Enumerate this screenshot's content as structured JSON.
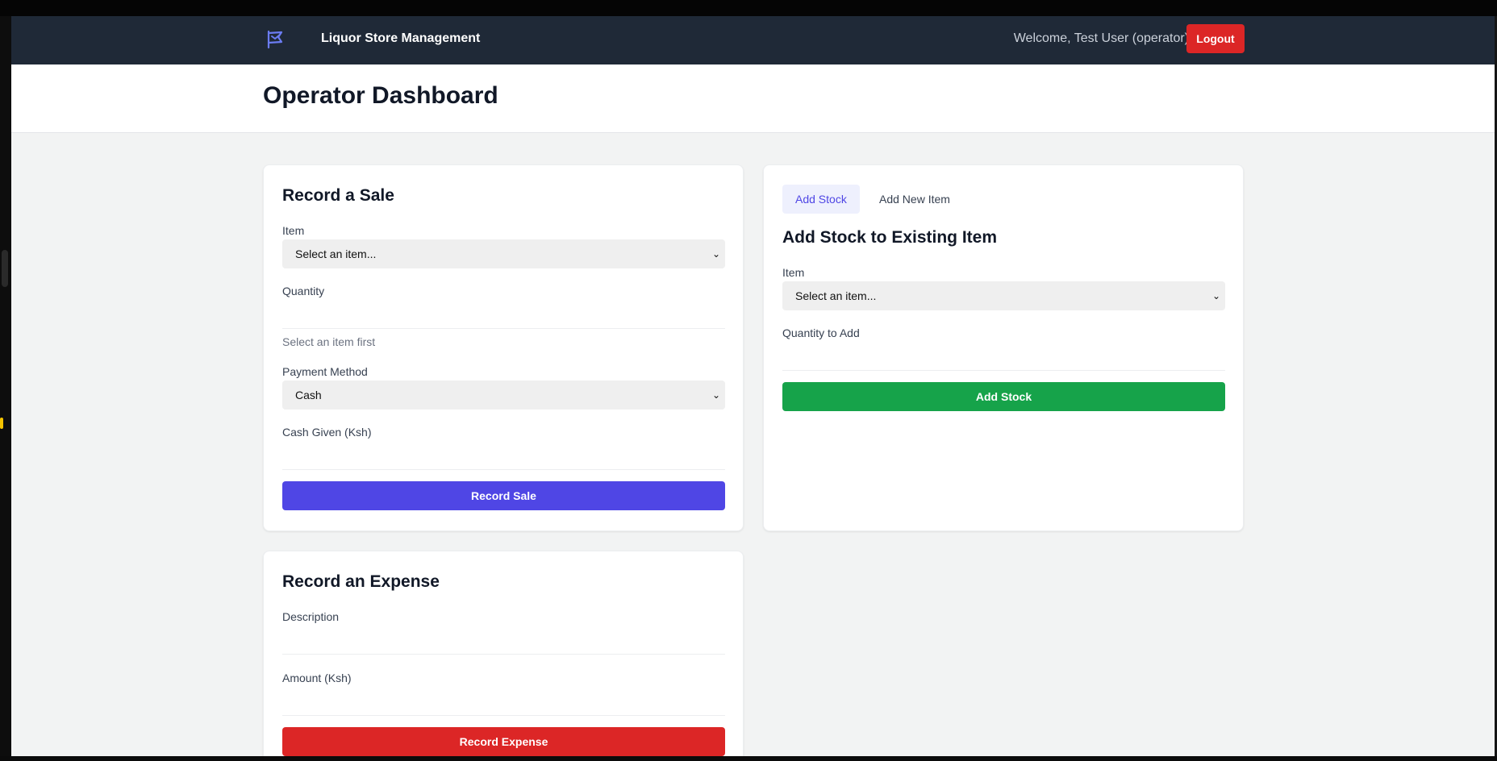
{
  "nav": {
    "title": "Liquor Store Management",
    "welcome": "Welcome, Test User (operator)",
    "logout": "Logout",
    "logo_icon": "store-flag-icon"
  },
  "header": {
    "title": "Operator Dashboard"
  },
  "sale": {
    "title": "Record a Sale",
    "item_label": "Item",
    "item_value": "Select an item...",
    "quantity_label": "Quantity",
    "quantity_hint": "Select an item first",
    "payment_label": "Payment Method",
    "payment_value": "Cash",
    "cash_label": "Cash Given (Ksh)",
    "submit": "Record Sale"
  },
  "stock": {
    "tabs": [
      {
        "label": "Add Stock",
        "active": true
      },
      {
        "label": "Add New Item",
        "active": false
      }
    ],
    "title": "Add Stock to Existing Item",
    "item_label": "Item",
    "item_value": "Select an item...",
    "quantity_label": "Quantity to Add",
    "submit": "Add Stock"
  },
  "expense": {
    "title": "Record an Expense",
    "description_label": "Description",
    "amount_label": "Amount (Ksh)",
    "submit": "Record Expense"
  },
  "colors": {
    "nav_bg": "#1f2937",
    "primary": "#4f46e5",
    "success": "#16a34a",
    "danger": "#dc2626"
  }
}
